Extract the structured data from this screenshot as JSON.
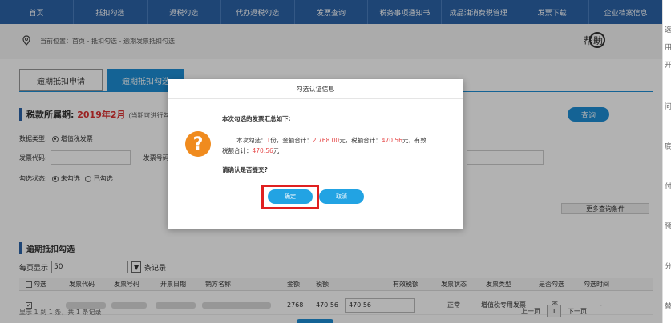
{
  "nav": [
    "首页",
    "抵扣勾选",
    "退税勾选",
    "代办退税勾选",
    "发票查询",
    "税务事项通知书",
    "成品油消费税管理",
    "发票下载",
    "企业档案信息"
  ],
  "breadcrumb": "当前位置：首页 - 抵扣勾选 - 逾期发票抵扣勾选",
  "help_label": "帮助",
  "tabs": {
    "tab1": "逾期抵扣申请",
    "tab2": "逾期抵扣勾选"
  },
  "section1": {
    "label": "税款所属期:",
    "period": "2019年2月",
    "hint": "(当期可进行勾选…"
  },
  "query_button": "查询",
  "form": {
    "data_type_label": "数据类型:",
    "data_type_value": "增值税发票",
    "invoice_code_label": "发票代码:",
    "invoice_no_label": "发票号码:",
    "check_status_label": "勾选状态:",
    "status_unchecked": "未勾选",
    "status_checked": "已勾选",
    "more_conditions": "更多查询条件"
  },
  "section2": {
    "label": "逾期抵扣勾选"
  },
  "page_size": {
    "prefix": "每页显示",
    "value": "50",
    "suffix": "条记录"
  },
  "table": {
    "headers": [
      "勾选",
      "发票代码",
      "发票号码",
      "开票日期",
      "销方名称",
      "金额",
      "税额",
      "有效税额",
      "发票状态",
      "发票类型",
      "是否勾选",
      "勾选时间"
    ],
    "row": {
      "checked": "✓",
      "amount": "2768",
      "tax": "470.56",
      "effective_tax": "470.56",
      "status": "正常",
      "type": "增值税专用发票",
      "is_checked": "否",
      "time": "-"
    }
  },
  "footer": "显示 1 到 1 条，共 1 条记录",
  "pager": {
    "prev": "上一页",
    "current": "1",
    "next": "下一页"
  },
  "right_strip": [
    "选",
    "用",
    "开",
    "问",
    "底",
    "付",
    "预",
    "分",
    "替"
  ],
  "modal": {
    "title": "勾选认证信息",
    "summary_title": "本次勾选的发票汇总如下:",
    "line_prefix": "本次勾选：",
    "count": "1",
    "count_unit": "份，金额合计：",
    "amount": "2,768.00",
    "amount_unit": "元，税额合计：",
    "tax": "470.56",
    "tax_unit": "元，有效",
    "eff_prefix": "税额合计：",
    "eff_tax": "470.56",
    "eff_unit": "元",
    "question": "请确认是否提交?",
    "confirm": "确定",
    "cancel": "取消"
  },
  "colors": {
    "nav": "#2c63a8",
    "accent": "#1e8fd6",
    "warning_icon": "#f08b1e",
    "highlight": "#e02020"
  }
}
